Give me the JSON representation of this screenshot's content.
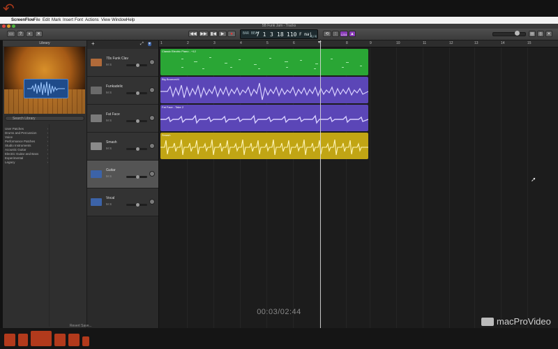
{
  "menubar": {
    "apple": "",
    "app_name": "ScreenFlow",
    "items": [
      "File",
      "Edit",
      "Mark",
      "Insert",
      "Font",
      "Actions",
      "View",
      "Window",
      "Help"
    ]
  },
  "window": {
    "title": "5B Funk Jam - Tracks"
  },
  "toolbar": {
    "buttons": {
      "library": "▭",
      "help": "?",
      "smart_controls": "◐",
      "editors": "✕",
      "rewind": "◀◀",
      "fast_forward": "▶▶",
      "go_to_start": "▮◀",
      "play": "▶",
      "record": "●",
      "cycle": "⟲",
      "tuner": "⫶",
      "count_in": "1234",
      "metronome": "▲",
      "notepad": "▤",
      "loops": "◎"
    },
    "lcd": {
      "bar_beat": "7 1",
      "tempo_label": "110",
      "key": "F maj",
      "time_sig": "4/4",
      "small_left": "BAR BEAT",
      "sep1": "3",
      "sep2": "18"
    }
  },
  "library": {
    "title": "Library",
    "search_placeholder": "Search Library",
    "categories": [
      "User Patches",
      "Drums and Percussion",
      "Voice",
      "Performance Patches",
      "Studio Instruments",
      "Acoustic Guitar",
      "Electric Guitar and Bass",
      "Experimental",
      "Legacy"
    ],
    "bottom_button": "Revert",
    "bottom_button2": "Save..."
  },
  "tracks": [
    {
      "name": "70s Funk Clav",
      "controls": "M S",
      "icon": "keyboard-icon",
      "color": "#b06a3a"
    },
    {
      "name": "Funkadelic",
      "controls": "M S",
      "icon": "amp-icon",
      "color": "#6a6a6a"
    },
    {
      "name": "Fat Face",
      "controls": "M S",
      "icon": "speaker-icon",
      "color": "#7a7a7a"
    },
    {
      "name": "Smash",
      "controls": "M S",
      "icon": "drumkit-icon",
      "color": "#8a8a8a"
    },
    {
      "name": "Guitar",
      "controls": "M S",
      "icon": "audio-track-icon",
      "color": "#3c63a8"
    },
    {
      "name": "Vocal",
      "controls": "M S",
      "icon": "audio-track-icon",
      "color": "#3c63a8"
    }
  ],
  "ruler": {
    "bars": [
      "1",
      "2",
      "3",
      "4",
      "5",
      "6",
      "7",
      "8",
      "9",
      "10",
      "11",
      "12",
      "13",
      "14",
      "15"
    ]
  },
  "regions": [
    {
      "name": "Classic Electric Piano - +12",
      "color": "#2aa635",
      "kind": "midi"
    },
    {
      "name": "Big Bounce#4",
      "color": "#5b46b7",
      "kind": "audio"
    },
    {
      "name": "Fat Face - Take 2",
      "color": "#5b46b7",
      "kind": "audio"
    },
    {
      "name": "Smash",
      "color": "#c1a514",
      "kind": "drummer"
    }
  ],
  "timecode": "00:03/02:44",
  "brand": "macProVideo",
  "accent": "#3c63a8"
}
